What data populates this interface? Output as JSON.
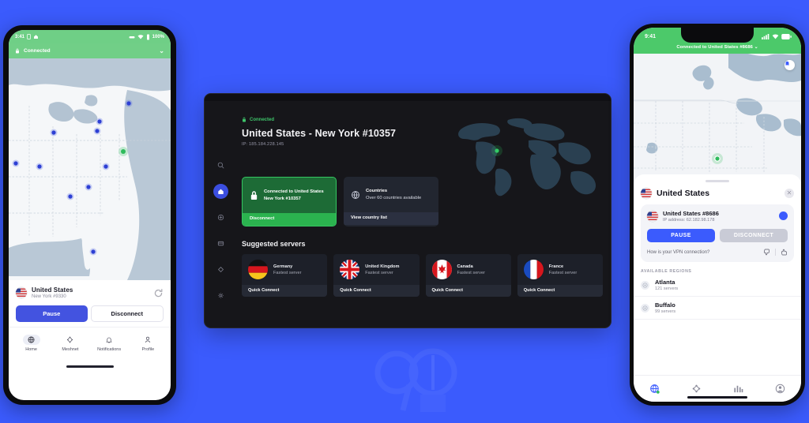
{
  "theme": {
    "background": "#3b5bfd",
    "brand_blue": "#3b5bfd",
    "connected_green": "#4cc96a",
    "dark_bg": "#16161a"
  },
  "watermark": {
    "text": "90"
  },
  "android_phone": {
    "status_bar": {
      "time": "3:41",
      "battery": "100%",
      "icons": [
        "sim-icon",
        "home-icon",
        "vpn-key-icon",
        "wifi-icon",
        "battery-icon"
      ]
    },
    "connection_bar": {
      "label": "Connected",
      "icon": "lock-icon",
      "expand_icon": "chevron-down-icon"
    },
    "server_card": {
      "country": "United States",
      "server": "New York #9330",
      "flag": "us-flag-icon",
      "refresh_icon": "refresh-icon",
      "pause_label": "Pause",
      "disconnect_label": "Disconnect"
    },
    "nav": [
      {
        "label": "Home",
        "icon": "globe-icon",
        "active": true
      },
      {
        "label": "Meshnet",
        "icon": "meshnet-icon",
        "active": false
      },
      {
        "label": "Notifications",
        "icon": "bell-icon",
        "active": false
      },
      {
        "label": "Profile",
        "icon": "person-icon",
        "active": false
      }
    ]
  },
  "desktop_app": {
    "sidebar": [
      {
        "name": "search",
        "icon": "search-icon",
        "active": false
      },
      {
        "name": "home",
        "icon": "home-icon",
        "active": true
      },
      {
        "name": "threat-protection",
        "icon": "shield-plus-icon",
        "active": false
      },
      {
        "name": "password-manager",
        "icon": "card-icon",
        "active": false
      },
      {
        "name": "meshnet",
        "icon": "meshnet-icon",
        "active": false
      },
      {
        "name": "settings",
        "icon": "gear-icon",
        "active": false
      }
    ],
    "status_badge": {
      "label": "Connected",
      "icon": "lock-icon"
    },
    "title": "United States - New York #10357",
    "ip_line": "IP: 185.184.228.145",
    "connection_card": {
      "icon": "lock-icon",
      "line1": "Connected to United States",
      "line2": "New York #10357",
      "action": "Disconnect"
    },
    "countries_card": {
      "icon": "globe-icon",
      "line1": "Countries",
      "line2": "Over 60 countries available",
      "action": "View country list"
    },
    "suggested_heading": "Suggested servers",
    "suggested_servers": [
      {
        "country": "Germany",
        "subtitle": "Fastest server",
        "action": "Quick Connect",
        "flag": "de-flag-icon"
      },
      {
        "country": "United Kingdom",
        "subtitle": "Fastest server",
        "action": "Quick Connect",
        "flag": "gb-flag-icon"
      },
      {
        "country": "Canada",
        "subtitle": "Fastest server",
        "action": "Quick Connect",
        "flag": "ca-flag-icon"
      },
      {
        "country": "France",
        "subtitle": "Fastest server",
        "action": "Quick Connect",
        "flag": "fr-flag-icon"
      }
    ]
  },
  "iphone": {
    "status_bar": {
      "time": "9:41",
      "icons": [
        "cellular-icon",
        "wifi-icon",
        "battery-icon"
      ]
    },
    "connection_banner": "Connected to United States #8686  ⌄",
    "map": {
      "bell_icon": "bell-icon"
    },
    "sheet": {
      "title": "United States",
      "flag": "us-flag-icon",
      "close_icon": "close-icon",
      "card": {
        "name": "United States #8686",
        "ip": "IP address: 62.182.98.178",
        "flag": "us-flag-icon",
        "status_icon": "connected-dot-icon"
      },
      "pause_label": "PAUSE",
      "disconnect_label": "DISCONNECT",
      "feedback_question": "How is your VPN connection?",
      "thumbs_down_icon": "thumbs-down-icon",
      "thumbs_up_icon": "thumbs-up-icon"
    },
    "regions_label": "AVAILABLE REGIONS",
    "regions": [
      {
        "name": "Atlanta",
        "servers": "121 servers",
        "icon": "location-pin-icon"
      },
      {
        "name": "Buffalo",
        "servers": "99 servers",
        "icon": "location-pin-icon"
      }
    ],
    "tabbar": [
      {
        "name": "vpn",
        "icon": "globe-connected-icon",
        "active": true
      },
      {
        "name": "meshnet",
        "icon": "meshnet-icon",
        "active": false
      },
      {
        "name": "stats",
        "icon": "bars-icon",
        "active": false
      },
      {
        "name": "profile",
        "icon": "person-circle-icon",
        "active": false
      }
    ]
  }
}
